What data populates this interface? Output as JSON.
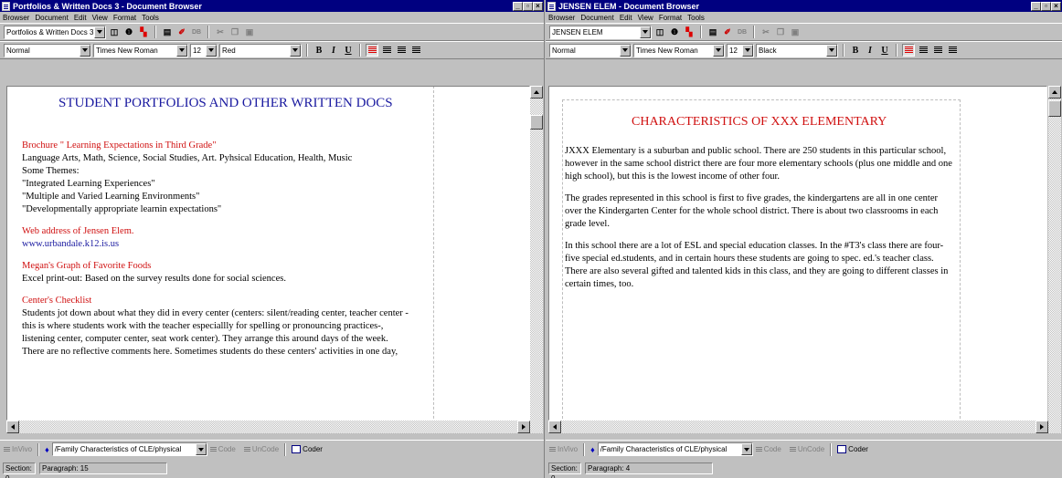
{
  "menu": [
    "Browser",
    "Document",
    "Edit",
    "View",
    "Format",
    "Tools"
  ],
  "left": {
    "window_title": "Portfolios & Written Docs 3 - Document Browser",
    "doc_select": "Portfolios & Written Docs 3",
    "style": "Normal",
    "font": "Times New Roman",
    "size": "12",
    "color": "Red",
    "doc_title": "STUDENT PORTFOLIOS AND OTHER WRITTEN DOCS",
    "lines": [
      {
        "text": "Brochure \" Learning Expectations in Third Grade\"",
        "kind": "red"
      },
      {
        "text": "Language Arts, Math, Science, Social Studies, Art. Pyhsical Education, Health, Music",
        "kind": "black"
      },
      {
        "text": "Some Themes:",
        "kind": "black"
      },
      {
        "text": "\"Integrated Learning Experiences\"",
        "kind": "black"
      },
      {
        "text": "\"Multiple and Varied Learning Environments\"",
        "kind": "black"
      },
      {
        "text": "\"Developmentally appropriate learnin expectations\"",
        "kind": "black"
      },
      {
        "text": "",
        "kind": "gap"
      },
      {
        "text": "Web address of Jensen Elem.",
        "kind": "red"
      },
      {
        "text": "www.urbandale.k12.is.us",
        "kind": "blue"
      },
      {
        "text": "",
        "kind": "gap"
      },
      {
        "text": "Megan's Graph of Favorite Foods",
        "kind": "red"
      },
      {
        "text": "Excel print-out: Based on the survey results done for social sciences.",
        "kind": "black"
      },
      {
        "text": "",
        "kind": "gap"
      },
      {
        "text": "Center's Checklist",
        "kind": "red"
      },
      {
        "text": "Students jot down about what they did in every center (centers: silent/reading  center, teacher center -",
        "kind": "black"
      },
      {
        "text": "this is where students work with the teacher especiallly for spelling or pronouncing practices-,",
        "kind": "black"
      },
      {
        "text": "listening center, computer center, seat work center). They arrange this around days of the week.",
        "kind": "black"
      },
      {
        "text": "There are no reflective comments here. Sometimes students do these centers' activities in one day,",
        "kind": "black"
      }
    ],
    "code_select": "/Family Characteristics of CLE/physical",
    "status_section": "Section: 0",
    "status_paragraph": "Paragraph: 15"
  },
  "right": {
    "window_title": "JENSEN ELEM - Document Browser",
    "doc_select": "JENSEN ELEM",
    "style": "Normal",
    "font": "Times New Roman",
    "size": "12",
    "color": "Black",
    "doc_title": "CHARACTERISTICS OF XXX ELEMENTARY",
    "lines": [
      {
        "text": "JXXX Elementary is a suburban and public school. There are 250 students in this particular school,",
        "kind": "black"
      },
      {
        "text": "however in the same school district there are four more elementary schools (plus one middle and one",
        "kind": "black"
      },
      {
        "text": "high school), but this is the lowest income of other four.",
        "kind": "black"
      },
      {
        "text": "",
        "kind": "gap"
      },
      {
        "text": "The grades represented in this school is first to five grades, the kindergartens are all in one center",
        "kind": "black"
      },
      {
        "text": "over the Kindergarten Center for the whole school district. There is about  two classrooms in each",
        "kind": "black"
      },
      {
        "text": "grade level.",
        "kind": "black"
      },
      {
        "text": "",
        "kind": "gap"
      },
      {
        "text": "In this school there are a lot of ESL and special education classes. In the #T3's class there are four-",
        "kind": "black"
      },
      {
        "text": "five special ed.students, and in certain hours these students are going to spec. ed.'s teacher class.",
        "kind": "black"
      },
      {
        "text": "There are also several gifted and talented kids in this class, and they are going to different classes in",
        "kind": "black"
      },
      {
        "text": "certain times, too.",
        "kind": "black"
      }
    ],
    "code_select": "/Family Characteristics of CLE/physical",
    "status_section": "Section: 0",
    "status_paragraph": "Paragraph: 4"
  },
  "bottom_bar": {
    "invivo": "InVivo",
    "code": "Code",
    "uncode": "UnCode",
    "coder": "Coder"
  },
  "colors": {
    "title_bar": "#000080",
    "red_text": "#d01010",
    "link_blue": "#1a1aa0"
  }
}
